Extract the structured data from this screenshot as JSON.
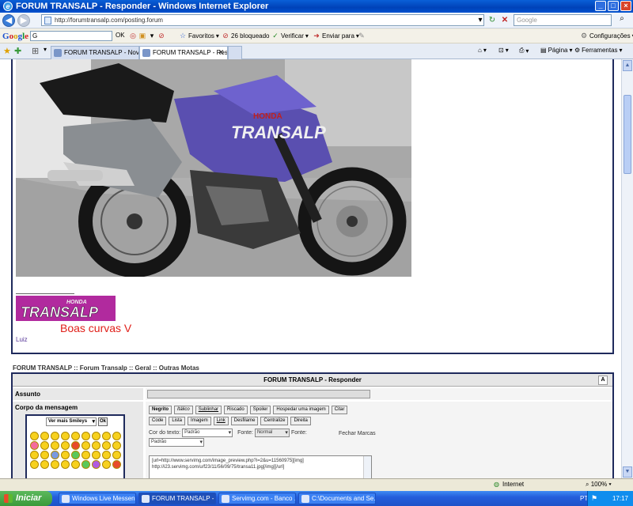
{
  "window": {
    "title": "FORUM TRANSALP - Responder - Windows Internet Explorer",
    "buttons": [
      "_",
      "□",
      "×"
    ]
  },
  "address_bar": {
    "url": "http://forumtransalp.com/posting.forum",
    "search_placeholder": "Google"
  },
  "google_toolbar": {
    "logo": "Google",
    "search_value": "G",
    "ok": "OK",
    "favoritos": "Favoritos",
    "bloqueado": "26 bloqueado",
    "verificar": "Verificar",
    "enviar": "Enviar para",
    "configuracoes": "Configurações"
  },
  "tabs": [
    {
      "label": "FORUM TRANSALP - Novo Tó...",
      "active": false
    },
    {
      "label": "FORUM TRANSALP - Res...",
      "active": true
    }
  ],
  "tab_tools": {
    "pagina": "Página",
    "ferramentas": "Ferramentas"
  },
  "post": {
    "image_alt": "Honda Transalp motorcycle",
    "tank_brand": "HONDA",
    "tank_model": "TRANSALP",
    "signature_logo": "TRANSALP",
    "signature_honda": "HONDA",
    "signature_text": "Boas curvas V",
    "author": "Luiz"
  },
  "breadcrumb": "FORUM TRANSALP :: Forum Transalp :: Geral :: Outras Motas",
  "form": {
    "header": "FORUM TRANSALP - Responder",
    "help_icon": "A",
    "assunto_label": "Assunto",
    "corpo_label": "Corpo da mensagem",
    "smiley_select": "Ver mais Smileys",
    "smiley_ok": "Ok",
    "buttons_row1": [
      {
        "label": "Negrito",
        "style": "b"
      },
      {
        "label": "Itálico",
        "style": "i"
      },
      {
        "label": "Sublinhar",
        "style": "u"
      },
      {
        "label": "Riscado",
        "style": ""
      },
      {
        "label": "Spoiler",
        "style": ""
      },
      {
        "label": "Hospedar uma imagem",
        "style": ""
      },
      {
        "label": "Citar",
        "style": ""
      }
    ],
    "buttons_row2": [
      "Code",
      "Lista",
      "Imagem",
      "Link",
      "Desfilame",
      "Centralize",
      "Direita"
    ],
    "cor_label": "Cor do texto:",
    "cor_value": "Padrão",
    "fonte_label": "Fonte:",
    "fonte_value": "Normal",
    "fonte2_label": "Fonte:",
    "fonte2_value": "Padrão",
    "fechar_marcas": "Fechar Marcas",
    "textarea_line1": "[url=http://www.servimg.com/image_preview.php?i=2&u=11560975][img]",
    "textarea_line2": "http://i23.servimg.com/u/f23/11/56/09/75/transa11.jpg[/img][/url]"
  },
  "statusbar": {
    "zone": "Internet",
    "zoom": "100%"
  },
  "taskbar": {
    "start": "Iniciar",
    "tasks": [
      {
        "label": "Windows Live Messen...",
        "active": false
      },
      {
        "label": "FORUM TRANSALP - ...",
        "active": true
      },
      {
        "label": "Servimg.com - Banco ...",
        "active": false
      },
      {
        "label": "C:\\Documents and Se...",
        "active": false
      }
    ],
    "lang": "PT",
    "clock": "17:17"
  }
}
